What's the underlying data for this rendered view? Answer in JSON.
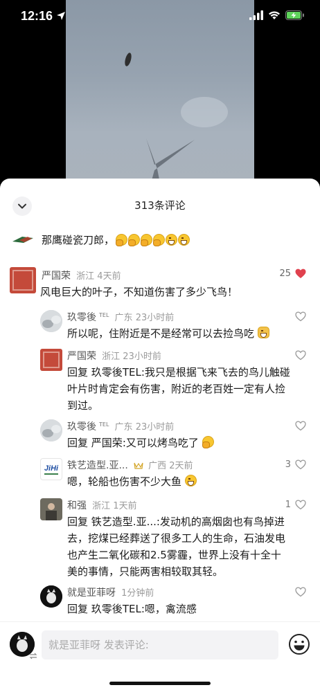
{
  "status_bar": {
    "time": "12:16"
  },
  "sheet": {
    "title": "313条评论"
  },
  "pinned": {
    "text": "那鹰碰瓷刀郎，",
    "emojis": [
      "hand-icon",
      "hand-icon",
      "hand-icon",
      "hand-icon",
      "grin-icon",
      "grin-icon"
    ]
  },
  "comments": [
    {
      "name": "严国荣",
      "region": "浙江",
      "time": "4天前",
      "text": "风电巨大的叶子，不知道伤害了多少飞鸟！",
      "likes": "25",
      "liked": true,
      "accent": "#e0414e"
    }
  ],
  "replies": [
    {
      "name": "玖零後",
      "tel": "TEL",
      "region": "广东",
      "time": "23小时前",
      "text": "所以呢，住附近是不是经常可以去捡鸟吃",
      "likes": ""
    },
    {
      "name": "严国荣",
      "tel": "",
      "region": "浙江",
      "time": "23小时前",
      "prefix": "回复",
      "reply_to": "玖零後",
      "reply_tel": "TEL",
      "text_lines": [
        ":我只是根据飞来飞去的鸟儿触碰",
        "叶片时肯定会有伤害，附近的老百姓一定有人捡",
        "到过。"
      ],
      "likes": ""
    },
    {
      "name": "玖零後",
      "tel": "TEL",
      "region": "广东",
      "time": "23小时前",
      "prefix": "回复",
      "reply_to": "严国荣",
      "text": ":又可以烤鸟吃了",
      "likes": ""
    },
    {
      "name": "铁艺造型.亚...",
      "region": "广西",
      "time": "2天前",
      "text": "嗯，轮船也伤害不少大鱼",
      "likes": "3"
    },
    {
      "name": "和强",
      "region": "浙江",
      "time": "1天前",
      "prefix": "回复",
      "reply_to": "铁艺造型.亚...",
      "text_lines": [
        ":发动机的高烟囱也有鸟掉进",
        "去，挖煤已经葬送了很多工人的生命，石油发电",
        "也产生二氧化碳和2.5雾霾，世界上没有十全十",
        "美的事情，只能两害相较取其轻。"
      ],
      "likes": "1"
    },
    {
      "name": "就是亚菲呀",
      "time": "1分钟前",
      "prefix": "回复",
      "reply_to": "玖零後",
      "reply_tel": "TEL",
      "text": ":嗯，禽流感",
      "likes": ""
    }
  ],
  "logo_text": "JiHi",
  "input": {
    "placeholder": "就是亚菲呀 发表评论:"
  }
}
